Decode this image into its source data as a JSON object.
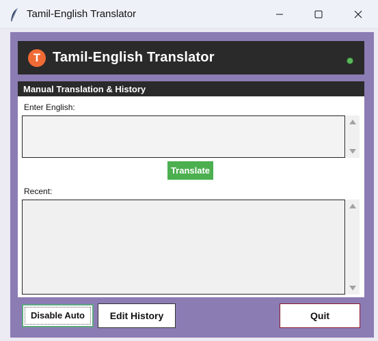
{
  "window": {
    "title": "Tamil-English Translator",
    "icon": "feather-icon",
    "controls": [
      "minimize-icon",
      "maximize-icon",
      "close-icon"
    ]
  },
  "header": {
    "logo_letter": "T",
    "title": "Tamil-English Translator",
    "status_color": "#5cb85c"
  },
  "panel": {
    "title": "Manual Translation & History",
    "english_label": "Enter English:",
    "english_value": "",
    "translate_label": "Translate",
    "recent_label": "Recent:",
    "recent_value": ""
  },
  "footer": {
    "disable_auto_label": "Disable Auto",
    "edit_history_label": "Edit History",
    "quit_label": "Quit"
  },
  "colors": {
    "frame": "#8c7cb4",
    "header_bg": "#2a2a2a",
    "logo": "#f06a35",
    "translate_button": "#4caf50",
    "quit_border": "#8b1a2b"
  }
}
